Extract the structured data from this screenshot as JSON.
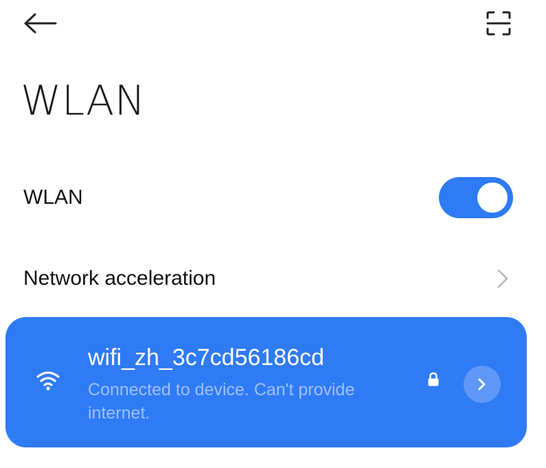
{
  "theme": {
    "accent": "#2f7bf5"
  },
  "header": {
    "back_icon": "arrow-left-icon",
    "scan_icon": "qr-scan-icon",
    "title": "WLAN"
  },
  "settings": {
    "wlan_toggle": {
      "label": "WLAN",
      "enabled": true
    },
    "network_acceleration": {
      "label": "Network acceleration",
      "icon": "chevron-right-icon"
    }
  },
  "connected_network": {
    "ssid": "wifi_zh_3c7cd56186cd",
    "status": "Connected to device. Can't provide internet.",
    "secured": true,
    "signal_icon": "wifi-icon",
    "lock_icon": "lock-icon",
    "detail_icon": "chevron-right-circle-icon"
  }
}
